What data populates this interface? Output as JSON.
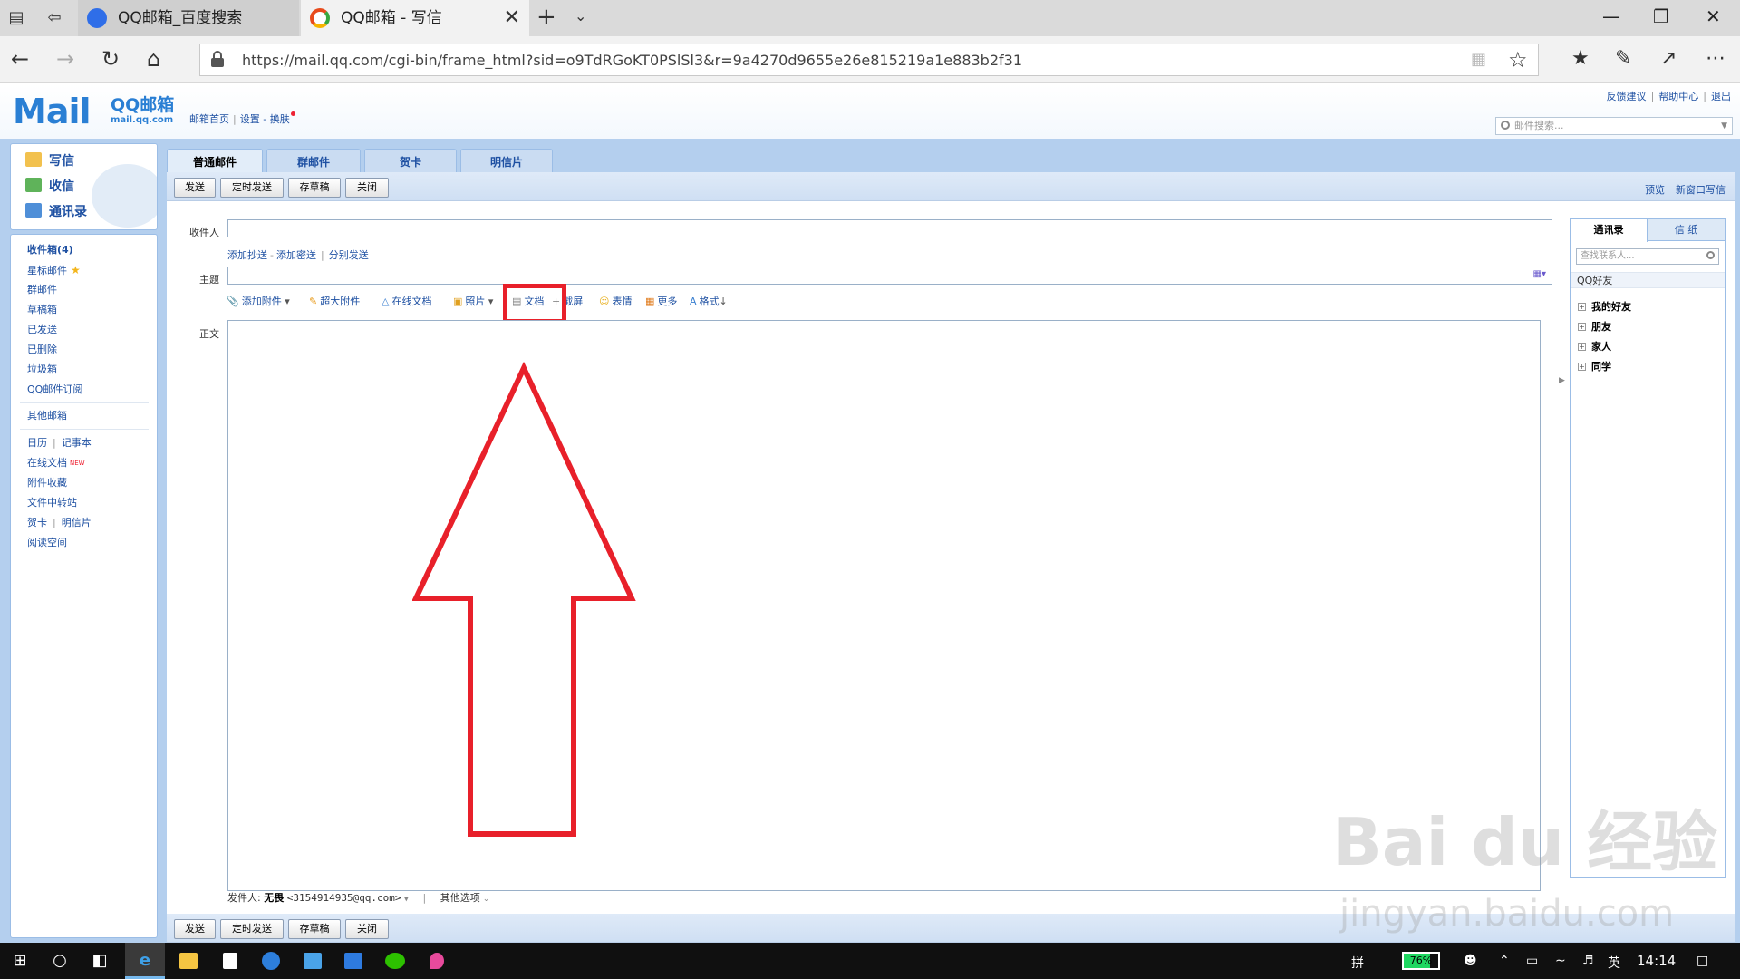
{
  "browser": {
    "tabs": [
      {
        "title": "QQ邮箱_百度搜索",
        "active": false
      },
      {
        "title": "QQ邮箱 - 写信",
        "active": true
      }
    ],
    "url": "https://mail.qq.com/cgi-bin/frame_html?sid=o9TdRGoKT0PSlSl3&r=9a4270d9655e26e815219a1e883b2f31"
  },
  "header": {
    "logo_main": "Mail",
    "logo_cn": "QQ邮箱",
    "logo_domain": "mail.qq.com",
    "nav": {
      "home": "邮箱首页",
      "settings": "设置",
      "dash": "-",
      "skin": "换肤"
    },
    "top_links": [
      "反馈建议",
      "帮助中心",
      "退出"
    ],
    "search_placeholder": "邮件搜索..."
  },
  "leftnav": {
    "primary": [
      {
        "label": "写信",
        "icon": "compose-icon"
      },
      {
        "label": "收信",
        "icon": "inbox-icon"
      },
      {
        "label": "通讯录",
        "icon": "contacts-icon"
      }
    ],
    "folders": {
      "inbox": "收件箱(4)",
      "starred": "星标邮件",
      "group": "群邮件",
      "drafts": "草稿箱",
      "sent": "已发送",
      "deleted": "已删除",
      "spam": "垃圾箱",
      "subscriptions": "QQ邮件订阅",
      "other": "其他邮箱"
    },
    "apps": {
      "calendar": "日历",
      "notepad": "记事本",
      "online_docs": "在线文档",
      "new_badge": "NEW",
      "attachments": "附件收藏",
      "transfer": "文件中转站",
      "card": "贺卡",
      "postcard": "明信片",
      "reading": "阅读空间"
    }
  },
  "compose": {
    "tabs": [
      "普通邮件",
      "群邮件",
      "贺卡",
      "明信片"
    ],
    "buttons": {
      "send": "发送",
      "scheduled": "定时发送",
      "draft": "存草稿",
      "close": "关闭"
    },
    "bar_links": {
      "preview": "预览",
      "new_window": "新窗口写信"
    },
    "fields": {
      "to_label": "收件人",
      "to_value": "",
      "add_cc": "添加抄送",
      "add_bcc": "添加密送",
      "separate": "分别发送",
      "subject_label": "主题",
      "subject_value": "",
      "body_label": "正文",
      "body_value": ""
    },
    "toolbar": {
      "attach": "添加附件",
      "big_attach": "超大附件",
      "online_doc": "在线文档",
      "photo": "照片",
      "doc": "文档",
      "screenshot": "截屏",
      "emoji": "表情",
      "more": "更多",
      "format": "格式"
    },
    "sender": {
      "label": "发件人:",
      "name": "无畏",
      "email": "<3154914935@qq.com>",
      "other_options": "其他选项"
    }
  },
  "contacts": {
    "tabs": [
      "通讯录",
      "信 纸"
    ],
    "search_placeholder": "查找联系人...",
    "group_title": "QQ好友",
    "groups": [
      "我的好友",
      "朋友",
      "家人",
      "同学"
    ]
  },
  "watermark": {
    "brand": "Bai du 经验",
    "domain": "jingyan.baidu.com"
  },
  "taskbar": {
    "ime": "拼",
    "battery": "76%",
    "battery_level": 0.76,
    "lang": "英",
    "time": "14:14"
  },
  "colors": {
    "accent": "#1e50a2",
    "frame": "#b4cfee",
    "highlight": "#e8202a"
  }
}
